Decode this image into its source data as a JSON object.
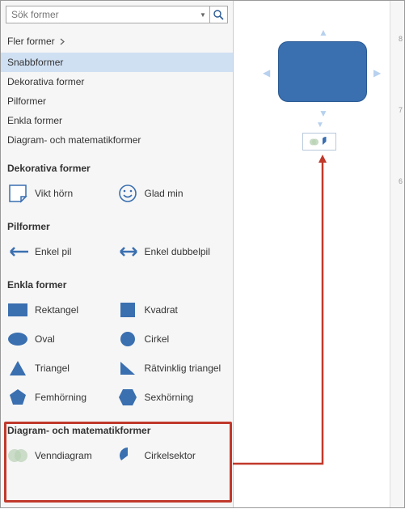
{
  "search": {
    "placeholder": "Sök former"
  },
  "nav": {
    "more": "Fler former",
    "items": [
      "Snabbformer",
      "Dekorativa former",
      "Pilformer",
      "Enkla former",
      "Diagram- och matematikformer"
    ],
    "selected": 0
  },
  "sections": {
    "dekorativa": {
      "title": "Dekorativa former",
      "items": [
        "Vikt hörn",
        "Glad min"
      ]
    },
    "pil": {
      "title": "Pilformer",
      "items": [
        "Enkel pil",
        "Enkel dubbelpil"
      ]
    },
    "enkla": {
      "title": "Enkla former",
      "items": [
        "Rektangel",
        "Kvadrat",
        "Oval",
        "Cirkel",
        "Triangel",
        "Rätvinklig triangel",
        "Femhörning",
        "Sexhörning"
      ]
    },
    "diagram": {
      "title": "Diagram- och matematikformer",
      "items": [
        "Venndiagram",
        "Cirkelsektor"
      ]
    }
  },
  "ruler": {
    "ticks": [
      "8",
      "7",
      "6"
    ]
  },
  "colors": {
    "shape_fill": "#3a6fb0",
    "shape_stroke": "#2a5a94",
    "callout": "#c0392b",
    "accent": "#b7d1ee"
  }
}
